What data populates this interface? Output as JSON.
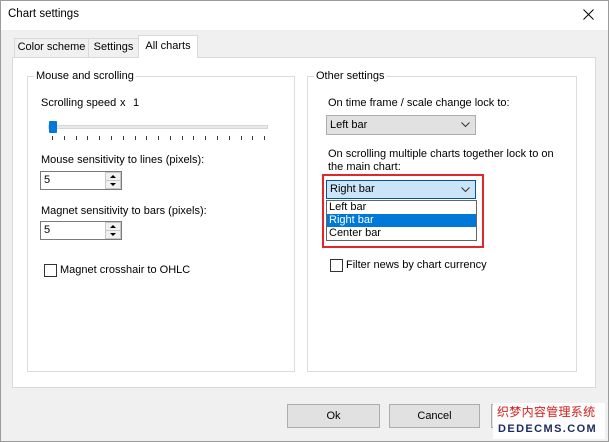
{
  "window": {
    "title": "Chart settings"
  },
  "icons": {
    "close": "close-icon",
    "dropdown": "chevron-down-icon",
    "spin_up": "spin-up-icon",
    "spin_down": "spin-down-icon",
    "checkmark": "checkmark-icon"
  },
  "colors": {
    "accent": "#0078d7",
    "highlight_frame": "#e3262e",
    "open_combo_bg": "#cce4f7",
    "open_combo_border": "#005499"
  },
  "tabs": [
    {
      "label": "Color scheme",
      "selected": false
    },
    {
      "label": "Settings",
      "selected": false
    },
    {
      "label": "All charts",
      "selected": true
    }
  ],
  "mouse_scrolling": {
    "legend": "Mouse and scrolling",
    "scrolling_speed": {
      "label": "Scrolling speed",
      "multiplier": "x",
      "value": "1",
      "slider_level": 0
    },
    "mouse_sensitivity": {
      "label": "Mouse sensitivity to lines (pixels):",
      "value": "5"
    },
    "magnet_sensitivity": {
      "label": "Magnet sensitivity to bars (pixels):",
      "value": "5"
    },
    "magnet_crosshair": {
      "label": "Magnet crosshair to OHLC",
      "checked": false
    }
  },
  "other_settings": {
    "legend": "Other settings",
    "timeframe_lock": {
      "label": "On time frame / scale change lock to:",
      "value": "Left bar"
    },
    "scroll_lock": {
      "label": "On scrolling multiple charts together lock to on the main chart:",
      "value": "Right bar",
      "dropdown_open": true,
      "options": [
        "Left bar",
        "Right bar",
        "Center bar"
      ],
      "highlighted_index": 1
    },
    "filter_news": {
      "label": "Filter news by chart currency",
      "checked": false
    }
  },
  "buttons": {
    "ok": "Ok",
    "cancel": "Cancel"
  },
  "watermark": {
    "line1": "织梦内容管理系统",
    "line2": "DEDECMS.COM"
  }
}
